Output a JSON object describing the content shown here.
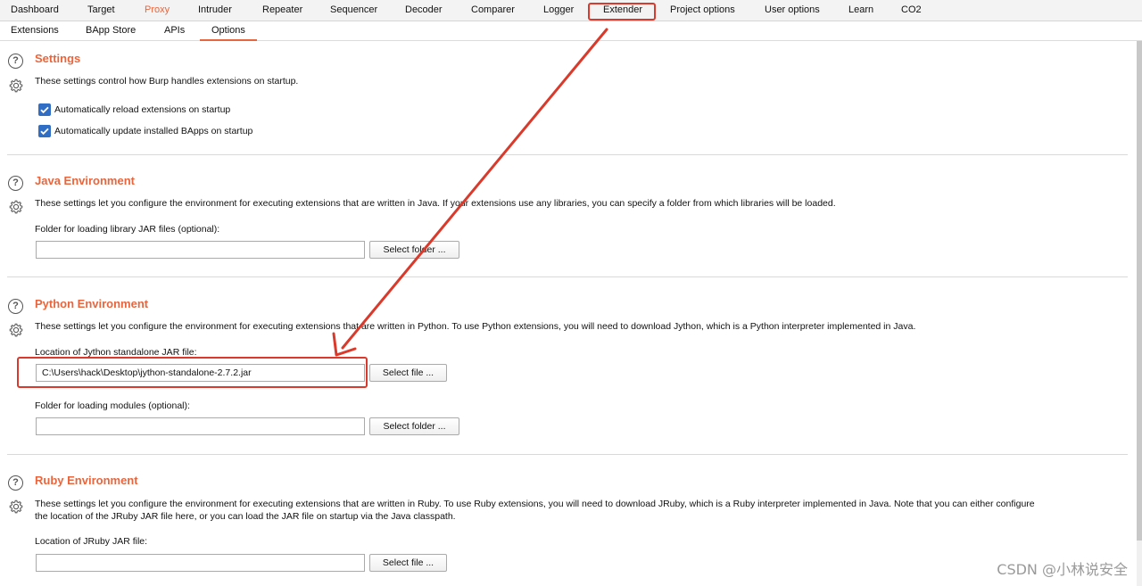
{
  "main_tabs": [
    {
      "label": "Dashboard"
    },
    {
      "label": "Target"
    },
    {
      "label": "Proxy"
    },
    {
      "label": "Intruder"
    },
    {
      "label": "Repeater"
    },
    {
      "label": "Sequencer"
    },
    {
      "label": "Decoder"
    },
    {
      "label": "Comparer"
    },
    {
      "label": "Logger"
    },
    {
      "label": "Extender"
    },
    {
      "label": "Project options"
    },
    {
      "label": "User options"
    },
    {
      "label": "Learn"
    },
    {
      "label": "CO2"
    }
  ],
  "sub_tabs": [
    {
      "label": "Extensions"
    },
    {
      "label": "BApp Store"
    },
    {
      "label": "APIs"
    },
    {
      "label": "Options"
    }
  ],
  "settings": {
    "title": "Settings",
    "description": "These settings control how Burp handles extensions on startup.",
    "option1": "Automatically reload extensions on startup",
    "option2": "Automatically update installed BApps on startup"
  },
  "java": {
    "title": "Java Environment",
    "description": "These settings let you configure the environment for executing extensions that are written in Java. If your extensions use any libraries, you can specify a folder from which libraries will be loaded.",
    "folder_label": "Folder for loading library JAR files (optional):",
    "folder_value": "",
    "select_button": "Select folder ..."
  },
  "python": {
    "title": "Python Environment",
    "description": "These settings let you configure the environment for executing extensions that are written in Python. To use Python extensions, you will need to download Jython, which is a Python interpreter implemented in Java.",
    "jar_label": "Location of Jython standalone JAR file:",
    "jar_value": "C:\\Users\\hack\\Desktop\\jython-standalone-2.7.2.jar",
    "select_file_button": "Select file ...",
    "modules_label": "Folder for loading modules (optional):",
    "modules_value": "",
    "select_folder_button": "Select folder ..."
  },
  "ruby": {
    "title": "Ruby Environment",
    "description": "These settings let you configure the environment for executing extensions that are written in Ruby. To use Ruby extensions, you will need to download JRuby, which is a Ruby interpreter implemented in Java. Note that you can either configure the location of the JRuby JAR file here, or you can load the JAR file on startup via the Java classpath.",
    "jar_label": "Location of JRuby JAR file:",
    "jar_value": "",
    "select_file_button": "Select file ..."
  },
  "watermark": "CSDN @小林说安全",
  "colors": {
    "accent_orange": "#e8663d",
    "annotation_red": "#d93a2b",
    "checkbox_blue": "#2f6ec4"
  }
}
